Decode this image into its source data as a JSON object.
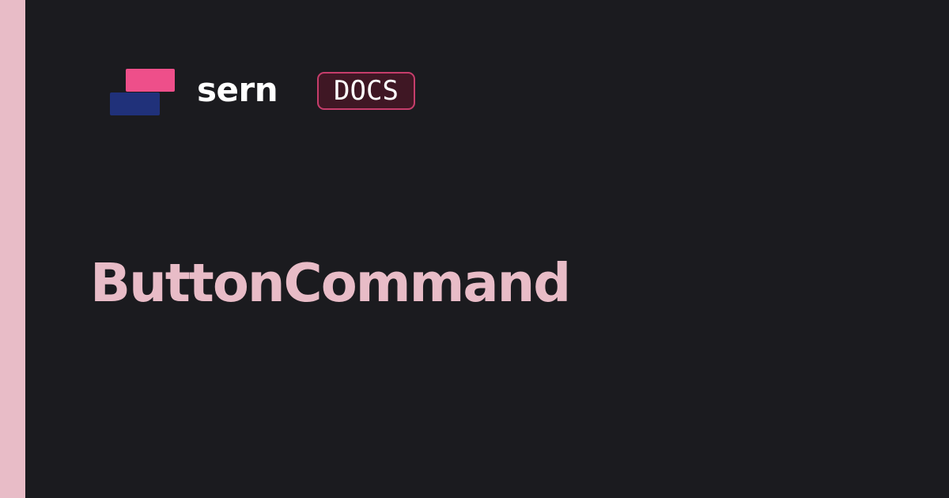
{
  "brand": {
    "name": "sern",
    "badge": "DOCS",
    "logo_colors": {
      "top": "#ee4f8a",
      "bottom": "#20317a"
    }
  },
  "title": "ButtonCommand",
  "colors": {
    "background": "#1b1b1f",
    "accent_stripe": "#e8bcc7",
    "title": "#e8bcc7",
    "badge_border": "#c63d6b",
    "badge_background": "#3f1724"
  }
}
